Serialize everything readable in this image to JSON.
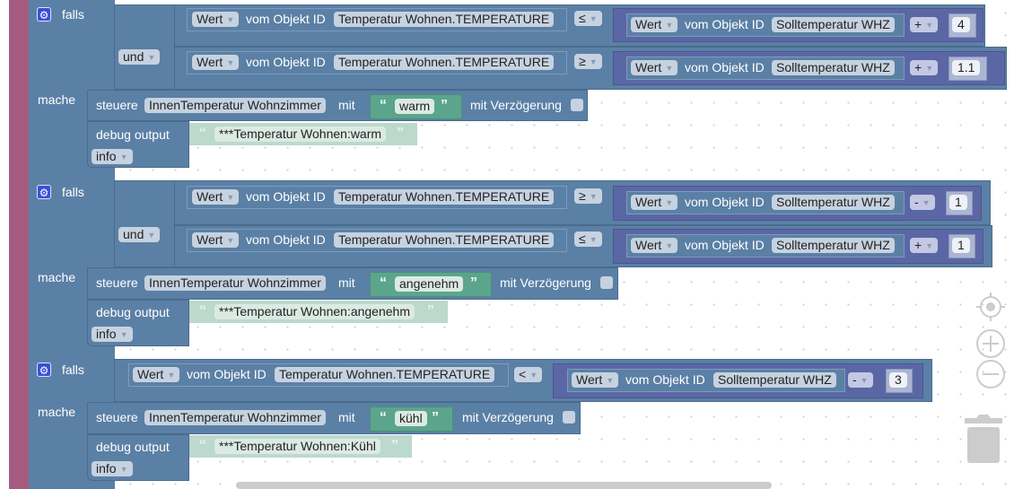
{
  "blocks": [
    {
      "if_label": "falls",
      "do_label": "mache",
      "logic_op": "und",
      "conditions": [
        {
          "left": {
            "mode": "Wert",
            "label": "vom Objekt ID",
            "object": "Temperatur Wohnen.TEMPERATURE"
          },
          "operator": "≤",
          "right": {
            "mode": "Wert",
            "label": "vom Objekt ID",
            "object": "Solltemperatur WHZ",
            "arith": "+",
            "number": "4"
          }
        },
        {
          "left": {
            "mode": "Wert",
            "label": "vom Objekt ID",
            "object": "Temperatur Wohnen.TEMPERATURE"
          },
          "operator": "≥",
          "right": {
            "mode": "Wert",
            "label": "vom Objekt ID",
            "object": "Solltemperatur WHZ",
            "arith": "+",
            "number": "1.1"
          }
        }
      ],
      "control": {
        "label": "steuere",
        "target": "InnenTemperatur Wohnzimmer",
        "with": "mit",
        "value": "warm",
        "delay_label": "mit Verzögerung"
      },
      "debug": {
        "label": "debug output",
        "message": "***Temperatur Wohnen:warm",
        "level": "info"
      }
    },
    {
      "if_label": "falls",
      "do_label": "mache",
      "logic_op": "und",
      "conditions": [
        {
          "left": {
            "mode": "Wert",
            "label": "vom Objekt ID",
            "object": "Temperatur Wohnen.TEMPERATURE"
          },
          "operator": "≥",
          "right": {
            "mode": "Wert",
            "label": "vom Objekt ID",
            "object": "Solltemperatur WHZ",
            "arith": "-",
            "number": "1"
          }
        },
        {
          "left": {
            "mode": "Wert",
            "label": "vom Objekt ID",
            "object": "Temperatur Wohnen.TEMPERATURE"
          },
          "operator": "≤",
          "right": {
            "mode": "Wert",
            "label": "vom Objekt ID",
            "object": "Solltemperatur WHZ",
            "arith": "+",
            "number": "1"
          }
        }
      ],
      "control": {
        "label": "steuere",
        "target": "InnenTemperatur Wohnzimmer",
        "with": "mit",
        "value": "angenehm",
        "delay_label": "mit Verzögerung"
      },
      "debug": {
        "label": "debug output",
        "message": "***Temperatur Wohnen:angenehm",
        "level": "info"
      }
    },
    {
      "if_label": "falls",
      "do_label": "mache",
      "conditions": [
        {
          "left": {
            "mode": "Wert",
            "label": "vom Objekt ID",
            "object": "Temperatur Wohnen.TEMPERATURE"
          },
          "operator": "<",
          "right": {
            "mode": "Wert",
            "label": "vom Objekt ID",
            "object": "Solltemperatur WHZ",
            "arith": "-",
            "number": "3"
          }
        }
      ],
      "control": {
        "label": "steuere",
        "target": "InnenTemperatur Wohnzimmer",
        "with": "mit",
        "value": "kühl",
        "delay_label": "mit Verzögerung"
      },
      "debug": {
        "label": "debug output",
        "message": "***Temperatur Wohnen:Kühl",
        "level": "info"
      }
    }
  ],
  "controls": {
    "recenter": "target-icon",
    "zoom_in": "plus-circle-icon",
    "zoom_out": "minus-circle-icon",
    "trash": "trash-icon"
  },
  "glyphs": {
    "gear": "⚙",
    "caret": "▼",
    "open_quote": "“",
    "close_quote": "”"
  },
  "colors": {
    "event_block": "#a55b80",
    "logic_block": "#5b80a5",
    "math_block": "#5b67a5",
    "text_block": "#5ba58c",
    "gear_mutator": "#3a4fd6"
  }
}
